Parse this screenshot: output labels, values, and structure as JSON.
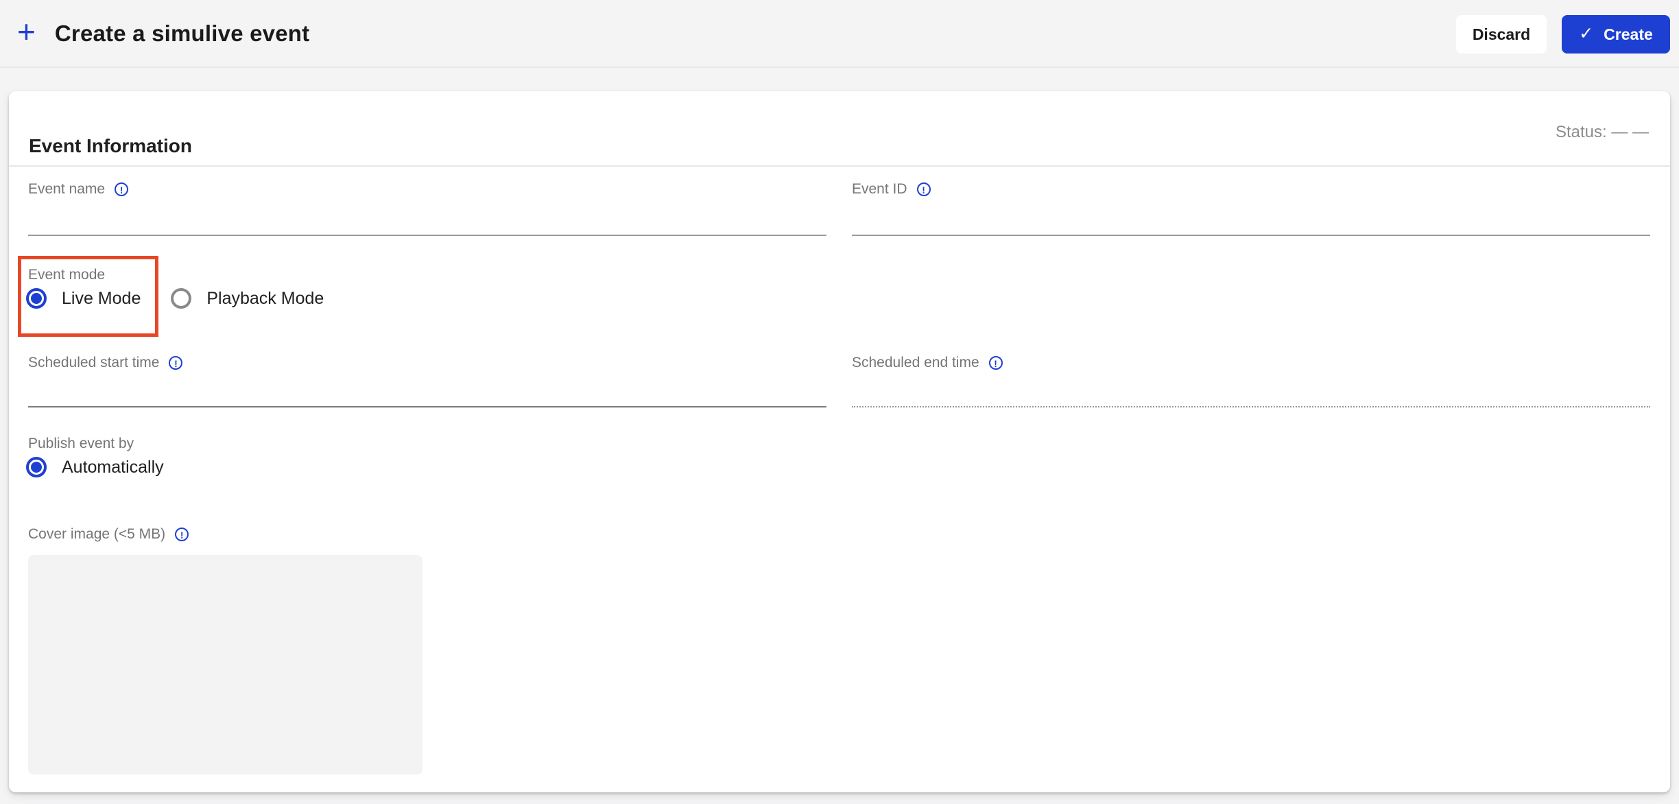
{
  "header": {
    "plus_icon": "+",
    "title": "Create a simulive event",
    "buttons": {
      "discard": "Discard",
      "create": "Create",
      "create_check_icon": "✓"
    }
  },
  "panel": {
    "title": "Event Information",
    "status": "Status: — —"
  },
  "form": {
    "event_name": {
      "label": "Event name",
      "value": ""
    },
    "event_id": {
      "label": "Event ID",
      "value": ""
    },
    "event_mode": {
      "label": "Event mode",
      "options": [
        {
          "label": "Live Mode",
          "selected": true
        },
        {
          "label": "Playback Mode",
          "selected": false
        }
      ]
    },
    "scheduled_start": {
      "label": "Scheduled start time",
      "value": ""
    },
    "scheduled_end": {
      "label": "Scheduled end time",
      "value": ""
    },
    "publish_by": {
      "label": "Publish event by",
      "options": [
        {
          "label": "Automatically",
          "selected": true
        }
      ]
    },
    "cover_image": {
      "label": "Cover image (<5 MB)"
    }
  },
  "icons": {
    "info": "!"
  },
  "colors": {
    "accent": "#1e40d2",
    "highlight": "#e84727"
  }
}
